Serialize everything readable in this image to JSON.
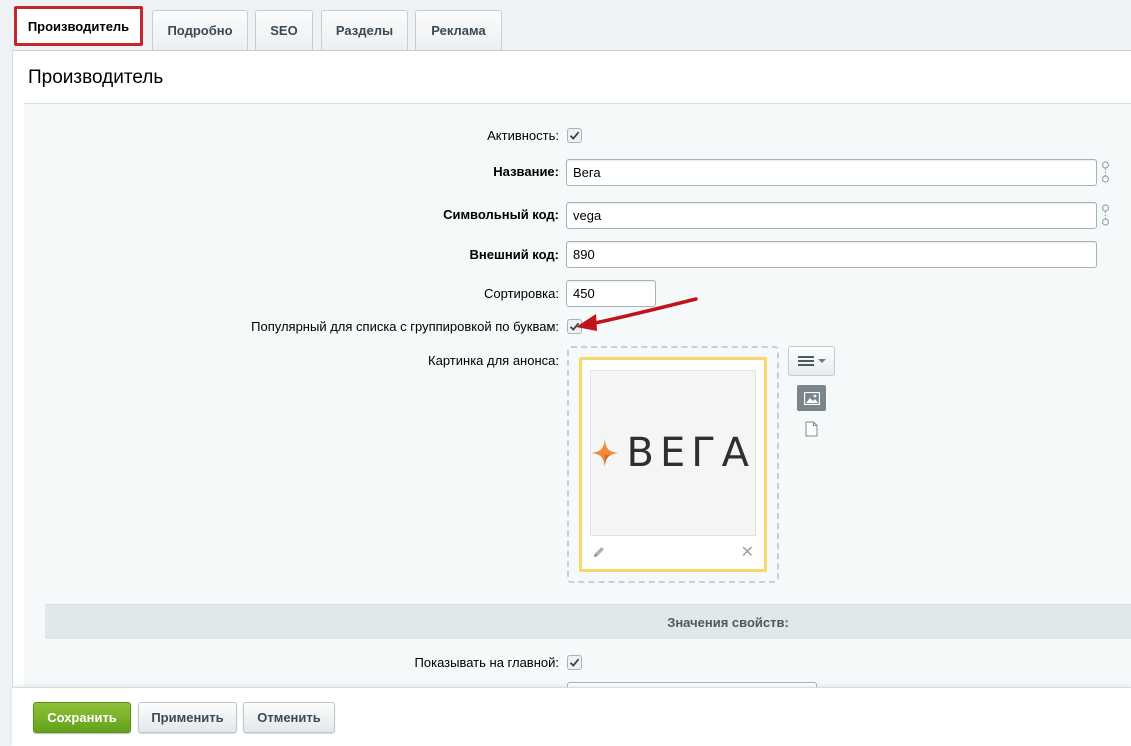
{
  "tabs": [
    {
      "label": "Производитель",
      "active": true
    },
    {
      "label": "Подробно",
      "active": false
    },
    {
      "label": "SEO",
      "active": false
    },
    {
      "label": "Разделы",
      "active": false
    },
    {
      "label": "Реклама",
      "active": false
    }
  ],
  "panel": {
    "title": "Производитель"
  },
  "form": {
    "active_label": "Активность:",
    "active_checked": true,
    "name_label": "Название:",
    "name_value": "Вега",
    "code_label": "Символьный код:",
    "code_value": "vega",
    "xml_label": "Внешний код:",
    "xml_value": "890",
    "sort_label": "Сортировка:",
    "sort_value": "450",
    "popular_label": "Популярный для списка с группировкой по буквам:",
    "popular_checked": true,
    "preview_label": "Картинка для анонса:",
    "preview_logo_text": "ВЕГА",
    "props_header": "Значения свойств:",
    "show_main_label": "Показывать на главной:",
    "show_main_checked": true
  },
  "footer": {
    "save_label": "Сохранить",
    "apply_label": "Применить",
    "cancel_label": "Отменить"
  },
  "colors": {
    "active_tab_border": "#c1272d",
    "save_button": "#75b022",
    "image_card_border": "#f6d96b",
    "arrow": "#c0141a",
    "logo_star": "#f08a3c"
  }
}
